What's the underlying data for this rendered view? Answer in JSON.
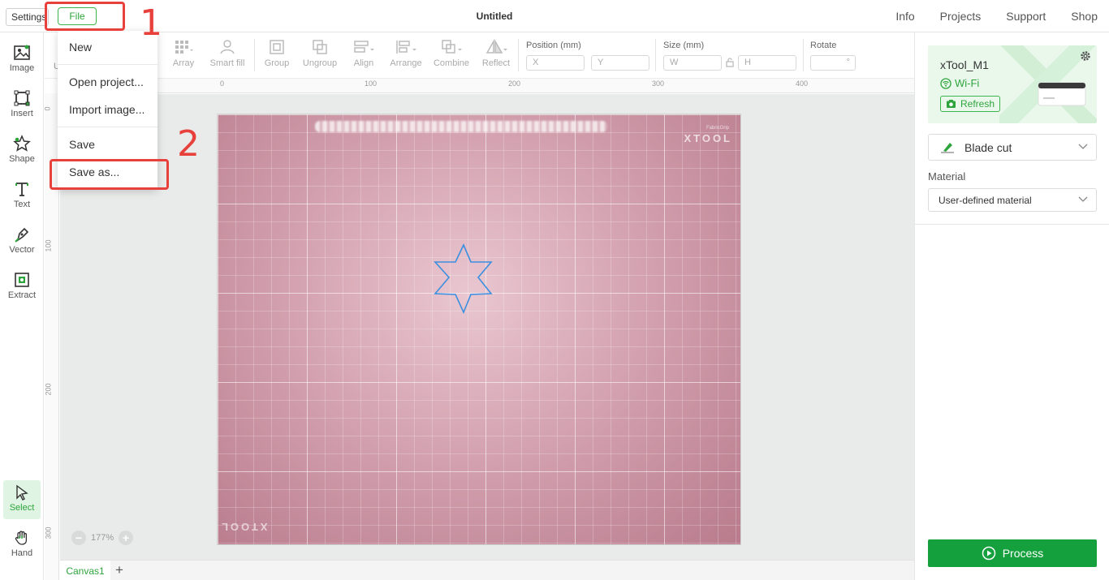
{
  "topbar": {
    "settings_label": "Settings",
    "file_label": "File",
    "title": "Untitled",
    "nav": [
      "Info",
      "Projects",
      "Support",
      "Shop"
    ]
  },
  "left_tools": [
    {
      "label": "Image",
      "icon": "image-icon"
    },
    {
      "label": "Insert",
      "icon": "insert-icon"
    },
    {
      "label": "Shape",
      "icon": "star-icon"
    },
    {
      "label": "Text",
      "icon": "text-icon"
    },
    {
      "label": "Vector",
      "icon": "pen-icon"
    },
    {
      "label": "Extract",
      "icon": "extract-icon"
    },
    {
      "label": "Select",
      "icon": "cursor-icon",
      "active": true
    },
    {
      "label": "Hand",
      "icon": "hand-icon"
    }
  ],
  "prop_tools": {
    "partial_label": "U",
    "array": "Array",
    "smart_fill": "Smart fill",
    "group": "Group",
    "ungroup": "Ungroup",
    "align": "Align",
    "arrange": "Arrange",
    "combine": "Combine",
    "reflect": "Reflect",
    "position_label": "Position (mm)",
    "x_placeholder": "X",
    "y_placeholder": "Y",
    "size_label": "Size (mm)",
    "w_placeholder": "W",
    "h_placeholder": "H",
    "rotate_label": "Rotate",
    "rotate_unit": "°"
  },
  "rulers": {
    "top": [
      "0",
      "100",
      "200",
      "300",
      "400"
    ],
    "left": [
      "0",
      "100",
      "200",
      "300"
    ]
  },
  "canvas": {
    "mat_brand": "XTOOL",
    "mat_sub": "FabricGrip",
    "zoom": "177%",
    "tab": "Canvas1",
    "add_tab": "+"
  },
  "file_menu": {
    "items": [
      "New",
      "Open project...",
      "Import image...",
      "Save",
      "Save as..."
    ]
  },
  "annotations": {
    "step1": "1",
    "step2": "2"
  },
  "right_panel": {
    "device_name": "xTool_M1",
    "connection": "Wi-Fi",
    "refresh": "Refresh",
    "mode": "Blade cut",
    "material_label": "Material",
    "material_value": "User-defined material",
    "process": "Process"
  },
  "colors": {
    "accent": "#2ea43d",
    "process": "#14a03c",
    "annotation": "#e8413c",
    "shape_stroke": "#3b8fe0"
  }
}
